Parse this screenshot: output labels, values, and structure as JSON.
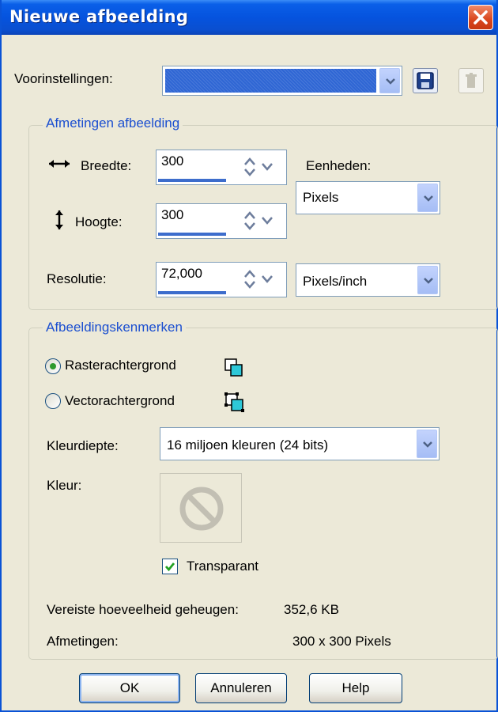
{
  "window": {
    "title": "Nieuwe afbeelding"
  },
  "presets": {
    "label": "Voorinstellingen:",
    "value": ""
  },
  "dimensions": {
    "group_title": "Afmetingen afbeelding",
    "width_label": "Breedte:",
    "width_value": "300",
    "height_label": "Hoogte:",
    "height_value": "300",
    "units_label": "Eenheden:",
    "units_value": "Pixels",
    "resolution_label": "Resolutie:",
    "resolution_value": "72,000",
    "resolution_unit": "Pixels/inch"
  },
  "characteristics": {
    "group_title": "Afbeeldingskenmerken",
    "raster_label": "Rasterachtergrond",
    "vector_label": "Vectorachtergrond",
    "selected_background": "raster",
    "color_depth_label": "Kleurdiepte:",
    "color_depth_value": "16 miljoen kleuren (24 bits)",
    "color_label": "Kleur:",
    "transparent_label": "Transparant",
    "transparent_checked": true,
    "memory_label": "Vereiste hoeveelheid geheugen:",
    "memory_value": "352,6 KB",
    "size_label": "Afmetingen:",
    "size_value": "300 x 300 Pixels"
  },
  "buttons": {
    "ok": "OK",
    "cancel": "Annuleren",
    "help": "Help"
  },
  "colors": {
    "titlebar": "#0553de",
    "dialog_bg": "#ece9d8",
    "group_title": "#1b4fd0",
    "selection": "#3d6dcc"
  }
}
